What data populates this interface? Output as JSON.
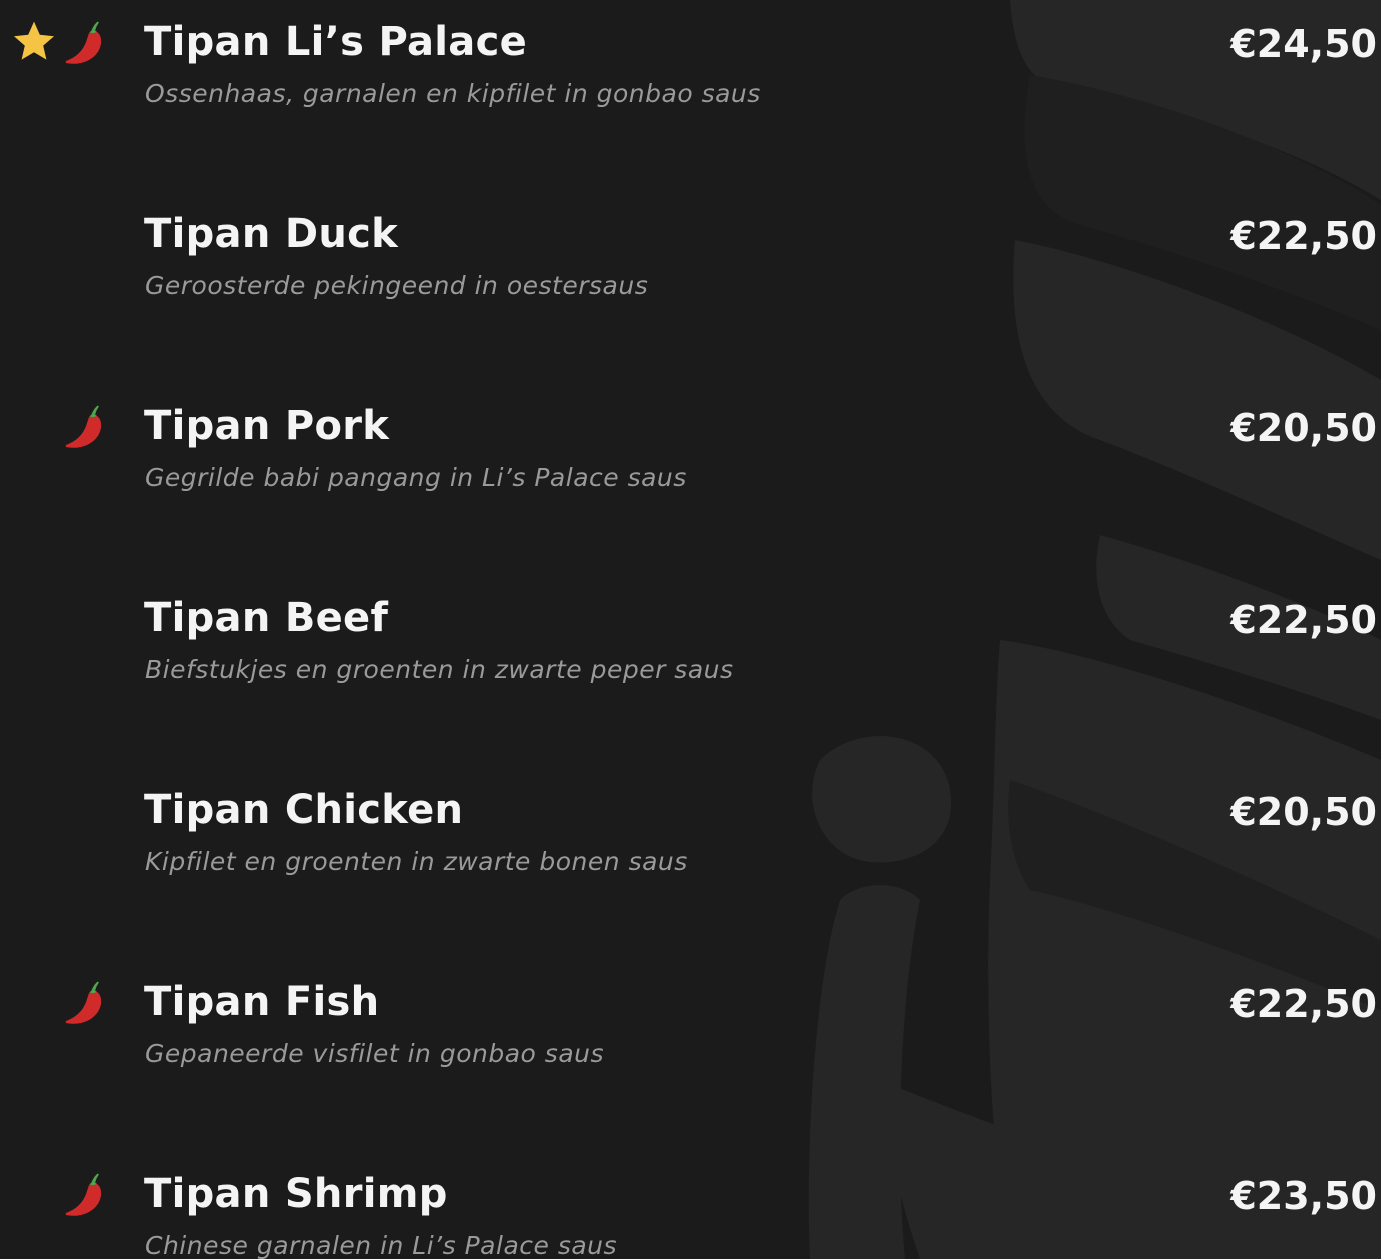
{
  "colors": {
    "background": "#1b1b1b",
    "watermark": "#262626",
    "item_name": "#f4f4f4",
    "item_description": "#9a9a9a",
    "item_price": "#f4f4f4",
    "star": "#f6c445",
    "chili": "#d12a2a",
    "chili_stem": "#4aa84a"
  },
  "menu": {
    "items": [
      {
        "name": "Tipan Li’s Palace",
        "description": "Ossenhaas, garnalen en kipfilet in gonbao saus",
        "price": "€24,50",
        "icons": [
          "star-icon",
          "chili-pepper-icon"
        ]
      },
      {
        "name": "Tipan Duck",
        "description": "Geroosterde pekingeend in oestersaus",
        "price": "€22,50",
        "icons": []
      },
      {
        "name": "Tipan Pork",
        "description": "Gegrilde babi pangang in Li’s Palace saus",
        "price": "€20,50",
        "icons": [
          "chili-pepper-icon"
        ]
      },
      {
        "name": "Tipan Beef",
        "description": "Biefstukjes en groenten in zwarte peper saus",
        "price": "€22,50",
        "icons": []
      },
      {
        "name": "Tipan Chicken",
        "description": "Kipfilet en groenten in zwarte bonen saus",
        "price": "€20,50",
        "icons": []
      },
      {
        "name": "Tipan Fish",
        "description": "Gepaneerde visfilet in gonbao saus",
        "price": "€22,50",
        "icons": [
          "chili-pepper-icon"
        ]
      },
      {
        "name": "Tipan Shrimp",
        "description": "Chinese garnalen in Li’s Palace saus",
        "price": "€23,50",
        "icons": [
          "chili-pepper-icon"
        ]
      }
    ]
  }
}
